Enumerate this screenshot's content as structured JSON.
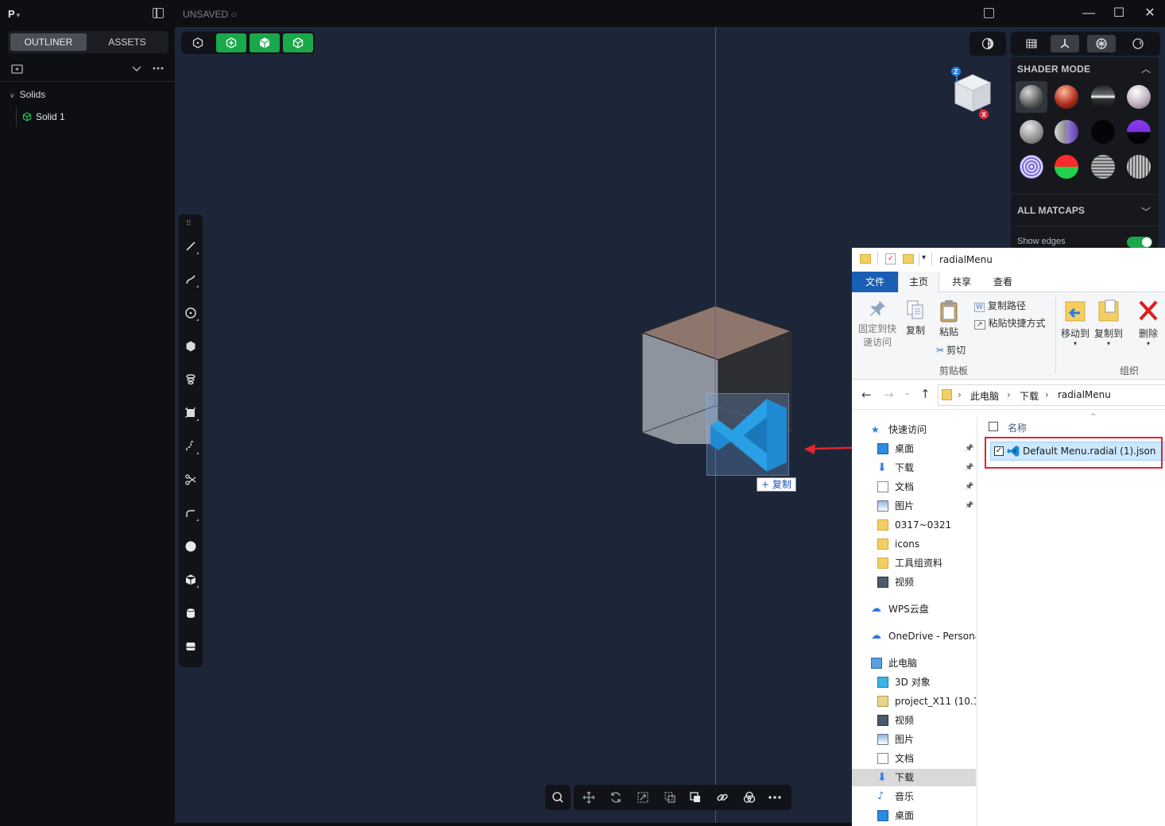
{
  "app": {
    "logo": "P",
    "status": "UNSAVED ○"
  },
  "sidebar": {
    "tabs": [
      "OUTLINER",
      "ASSETS"
    ],
    "active_tab": "OUTLINER",
    "tree_group": "Solids",
    "tree_item": "Solid 1"
  },
  "shader_panel": {
    "title": "SHADER MODE",
    "all_matcaps": "ALL MATCAPS",
    "show_edges": "Show edges",
    "show_edges_on": true
  },
  "navcube": {
    "z_label": "Z",
    "x_label": "X"
  },
  "drag": {
    "copy_label": "+ 复制"
  },
  "explorer": {
    "title": "radialMenu",
    "menus": [
      "文件",
      "主页",
      "共享",
      "查看"
    ],
    "ribbon": {
      "pin_label_1": "固定到快",
      "pin_label_2": "速访问",
      "copy": "复制",
      "paste": "粘贴",
      "copy_path": "复制路径",
      "paste_shortcut": "粘贴快捷方式",
      "cut": "剪切",
      "clipboard_group": "剪贴板",
      "move_to": "移动到",
      "copy_to": "复制到",
      "delete": "删除",
      "organize_group": "组织"
    },
    "breadcrumb": [
      "此电脑",
      "下载",
      "radialMenu"
    ],
    "column_name": "名称",
    "file_name": "Default Menu.radial (1).json",
    "nav": [
      {
        "label": "快速访问",
        "indent": 0,
        "icon": "star-icon",
        "pinned": false
      },
      {
        "label": "桌面",
        "indent": 1,
        "icon": "desktop-icon",
        "pinned": true
      },
      {
        "label": "下载",
        "indent": 1,
        "icon": "download-icon",
        "pinned": true
      },
      {
        "label": "文档",
        "indent": 1,
        "icon": "document-icon",
        "pinned": true
      },
      {
        "label": "图片",
        "indent": 1,
        "icon": "picture-icon",
        "pinned": true
      },
      {
        "label": "0317~0321",
        "indent": 1,
        "icon": "folder-icon",
        "pinned": false
      },
      {
        "label": "icons",
        "indent": 1,
        "icon": "folder-icon",
        "pinned": false
      },
      {
        "label": "工具组资料",
        "indent": 1,
        "icon": "folder-icon",
        "pinned": false
      },
      {
        "label": "视频",
        "indent": 1,
        "icon": "video-icon",
        "pinned": false
      },
      {
        "label": "WPS云盘",
        "indent": 0,
        "icon": "cloud-icon",
        "pinned": false
      },
      {
        "label": "OneDrive - Persona",
        "indent": 0,
        "icon": "cloud-icon",
        "pinned": false
      },
      {
        "label": "此电脑",
        "indent": 0,
        "icon": "computer-icon",
        "pinned": false
      },
      {
        "label": "3D 对象",
        "indent": 1,
        "icon": "cube-icon",
        "pinned": false
      },
      {
        "label": "project_X11 (10.1",
        "indent": 1,
        "icon": "drive-icon",
        "pinned": false
      },
      {
        "label": "视频",
        "indent": 1,
        "icon": "video-icon",
        "pinned": false
      },
      {
        "label": "图片",
        "indent": 1,
        "icon": "picture-icon",
        "pinned": false
      },
      {
        "label": "文档",
        "indent": 1,
        "icon": "document-icon",
        "pinned": false
      },
      {
        "label": "下载",
        "indent": 1,
        "icon": "download-icon",
        "pinned": false,
        "selected": true
      },
      {
        "label": "音乐",
        "indent": 1,
        "icon": "music-icon",
        "pinned": false
      },
      {
        "label": "桌面",
        "indent": 1,
        "icon": "desktop-icon",
        "pinned": false
      }
    ]
  },
  "colors": {
    "accent_green": "#19a84a",
    "viewport_bg": "#1d2638",
    "highlight_red": "#e0252f",
    "explorer_blue": "#1a5fb4"
  }
}
